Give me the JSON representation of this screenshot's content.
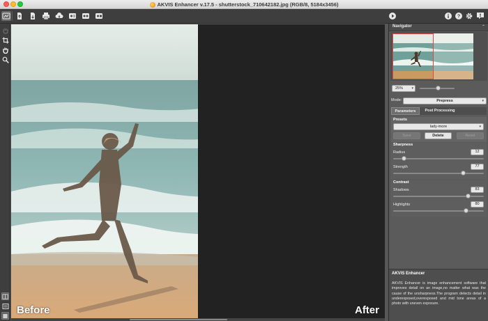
{
  "window": {
    "title": "AKVIS Enhancer v.17.5 - shutterstock_710642182.jpg (RGB/8, 5184x3456)"
  },
  "toolbar": {
    "left_icons": [
      "akvis-logo-icon",
      "open-file-icon",
      "save-file-icon",
      "print-icon",
      "share-cloud-icon",
      "batch-icon",
      "settings-extra-icon",
      "plugin-icon"
    ],
    "right_icons": [
      "run-icon",
      "info-icon",
      "help-icon",
      "preferences-icon",
      "notifications-icon"
    ]
  },
  "left_tools": [
    "hand-icon",
    "crop-icon",
    "pan-icon",
    "zoom-icon"
  ],
  "canvas": {
    "before_label": "Before",
    "after_label": "After"
  },
  "navigator": {
    "title": "Navigator",
    "zoom": "25%"
  },
  "mode": {
    "label": "Mode:",
    "value": "Prepress"
  },
  "tabs": {
    "parameters": "Parameters",
    "post_processing": "Post Processing"
  },
  "presets": {
    "title": "Presets",
    "selected": "lady-more",
    "save": "Save",
    "delete": "Delete",
    "reset": "Reset"
  },
  "sharpness": {
    "title": "Sharpness",
    "radius_label": "Radius",
    "radius_value": "12",
    "radius_fraction": 0.12,
    "strength_label": "Strength",
    "strength_value": "77",
    "strength_fraction": 0.77
  },
  "contrast": {
    "title": "Contrast",
    "shadows_label": "Shadows",
    "shadows_value": "83",
    "shadows_fraction": 0.83,
    "highlights_label": "Highlights",
    "highlights_value": "80",
    "highlights_fraction": 0.8
  },
  "info": {
    "title": "AKVIS Enhancer",
    "text": "AKVIS Enhancer is image enhancement software that improves detail on an image,no matter what was the cause of the unsharpness.The program detects detail in underexposed,overexposed and mid tone areas of a photo with uneven exposure."
  },
  "colors": {
    "panel": "#5b5b5b",
    "toolbar": "#3e3e3e",
    "slider_knob": "#dddddd"
  }
}
